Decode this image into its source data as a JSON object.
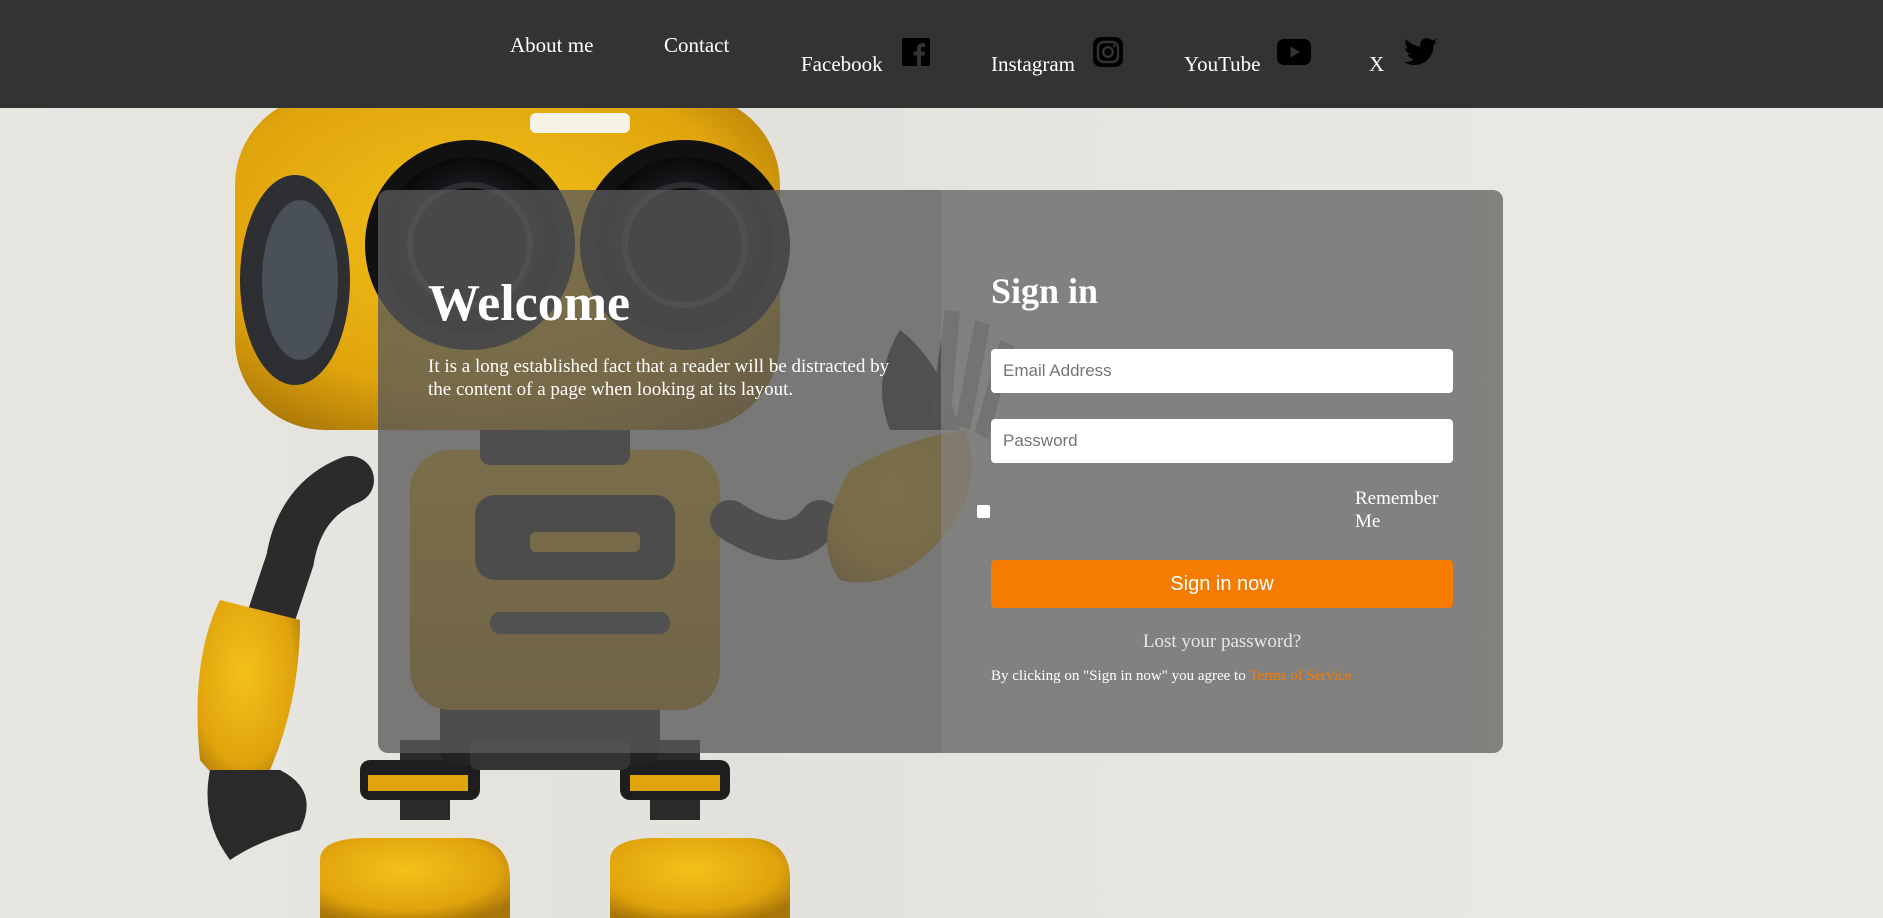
{
  "nav": {
    "about_label": "About me",
    "contact_label": "Contact",
    "facebook_label": "Facebook",
    "instagram_label": "Instagram",
    "youtube_label": "YouTube",
    "x_label": "X",
    "icons": [
      "facebook-icon",
      "instagram-icon",
      "youtube-icon",
      "twitter-icon"
    ]
  },
  "welcome": {
    "title": "Welcome",
    "text": "It is a long established fact that a reader will be distracted by the content of a page when looking at its layout."
  },
  "signin": {
    "title": "Sign in",
    "email_placeholder": "Email Address",
    "password_placeholder": "Password",
    "remember_label": "Remember Me",
    "button_label": "Sign in now",
    "lost_password": "Lost your password?",
    "terms_prefix": "By clicking on \"Sign in now\" you agree to ",
    "terms_link": "Terms of Service"
  },
  "colors": {
    "navbar": "#333333",
    "accent": "#f57c00",
    "text": "#ffffff"
  }
}
